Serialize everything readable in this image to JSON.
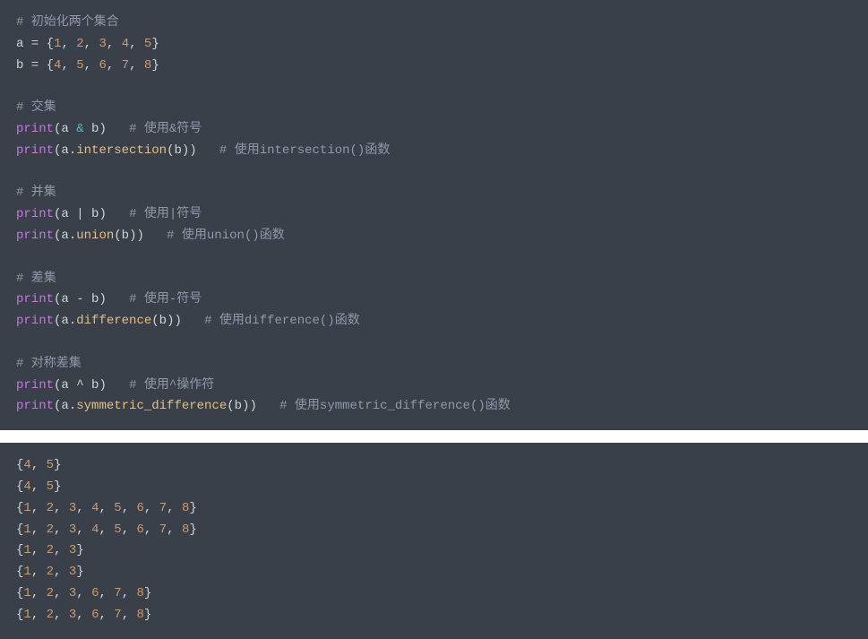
{
  "code": {
    "c1": "# 初始化两个集合",
    "l1_a": "a",
    "l1_eq": " = ",
    "l1_lb": "{",
    "l1_n1": "1",
    "l1_n2": "2",
    "l1_n3": "3",
    "l1_n4": "4",
    "l1_n5": "5",
    "l1_rb": "}",
    "comma": ", ",
    "l2_a": "b",
    "l2_eq": " = ",
    "l2_lb": "{",
    "l2_n1": "4",
    "l2_n2": "5",
    "l2_n3": "6",
    "l2_n4": "7",
    "l2_n5": "8",
    "l2_rb": "}",
    "c2": "# 交集",
    "print": "print",
    "lp": "(",
    "rp": ")",
    "a": "a",
    "b": "b",
    "sp": " ",
    "amp": "&",
    "c3": "# 使用&符号",
    "dot": ".",
    "m_int": "intersection",
    "c4": "# 使用intersection()函数",
    "c5": "# 并集",
    "pipe": "|",
    "c6": "# 使用|符号",
    "m_union": "union",
    "c7": "# 使用union()函数",
    "c8": "# 差集",
    "minus": "-",
    "c9": "# 使用-符号",
    "m_diff": "difference",
    "c10": "# 使用difference()函数",
    "c11": "# 对称差集",
    "caret": "^",
    "c12": "# 使用^操作符",
    "m_sym": "symmetric_difference",
    "c13": "# 使用symmetric_difference()函数",
    "pad3": "   ",
    "pad2": "  "
  },
  "output": {
    "o1": "{4, 5}",
    "o2": "{4, 5}",
    "o3": "{1, 2, 3, 4, 5, 6, 7, 8}",
    "o4": "{1, 2, 3, 4, 5, 6, 7, 8}",
    "o5": "{1, 2, 3}",
    "o6": "{1, 2, 3}",
    "o7": "{1, 2, 3, 6, 7, 8}",
    "o8": "{1, 2, 3, 6, 7, 8}"
  },
  "output_parsed": {
    "lines": [
      [
        4,
        5
      ],
      [
        4,
        5
      ],
      [
        1,
        2,
        3,
        4,
        5,
        6,
        7,
        8
      ],
      [
        1,
        2,
        3,
        4,
        5,
        6,
        7,
        8
      ],
      [
        1,
        2,
        3
      ],
      [
        1,
        2,
        3
      ],
      [
        1,
        2,
        3,
        6,
        7,
        8
      ],
      [
        1,
        2,
        3,
        6,
        7,
        8
      ]
    ]
  }
}
